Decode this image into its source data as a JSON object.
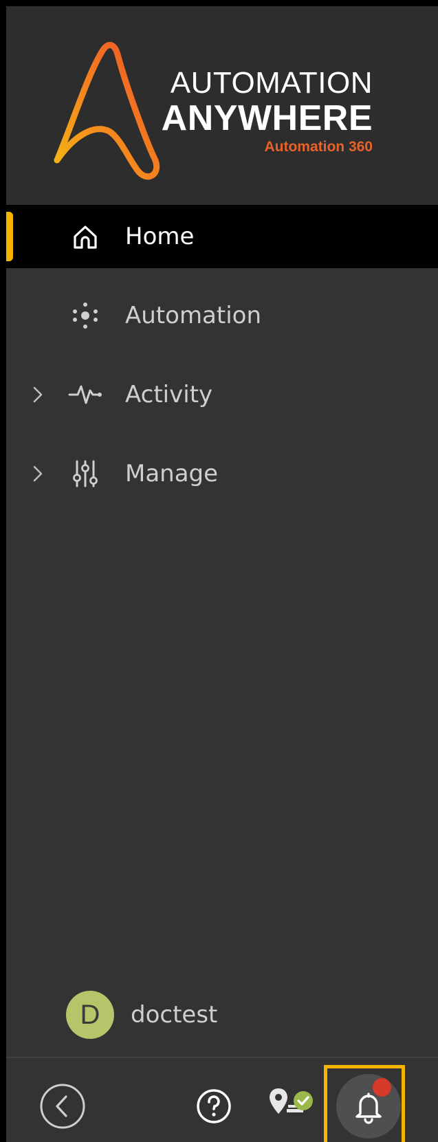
{
  "brand": {
    "line1": "AUTOMATION",
    "line2": "ANYWHERE",
    "line3": "Automation 360",
    "accent_color": "#f47c20",
    "tagline_color": "#e8622a",
    "gradient_colors": [
      "#f5b617",
      "#f47c20",
      "#e8502a"
    ]
  },
  "nav": {
    "items": [
      {
        "label": "Home",
        "icon": "home-icon",
        "active": true,
        "expandable": false
      },
      {
        "label": "Automation",
        "icon": "automation-icon",
        "active": false,
        "expandable": false
      },
      {
        "label": "Activity",
        "icon": "activity-icon",
        "active": false,
        "expandable": true
      },
      {
        "label": "Manage",
        "icon": "manage-icon",
        "active": false,
        "expandable": true
      }
    ],
    "active_indicator_color": "#f4b400",
    "text_color": "#cfcfcf",
    "active_text_color": "#ffffff"
  },
  "user": {
    "initial": "D",
    "name": "doctest",
    "avatar_color": "#b5c56a",
    "avatar_text_color": "#3a3a3a"
  },
  "footer": {
    "collapse_icon": "chevron-left-circle-icon",
    "help_icon": "help-circle-icon",
    "connector_icon": "bot-agent-status-icon",
    "connector_status_color": "#9bb84a",
    "notifications_icon": "bell-icon",
    "notification_dot_color": "#d63a2a",
    "highlight_color": "#f4b400"
  }
}
